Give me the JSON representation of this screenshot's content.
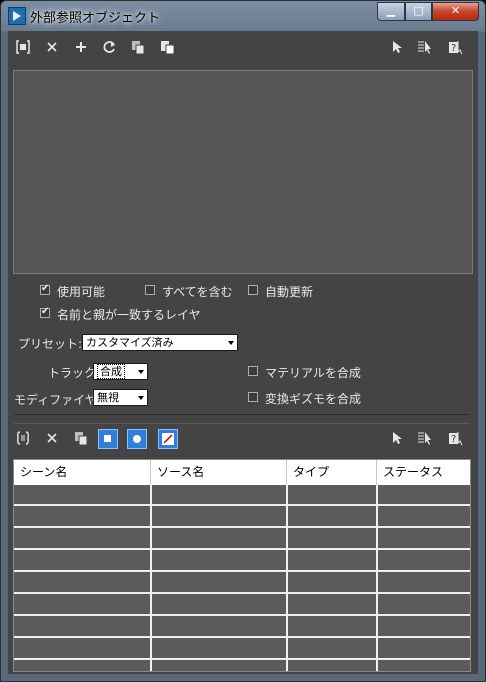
{
  "window": {
    "title": "外部参照オブジェクト",
    "min_glyph": "▁",
    "max_glyph": "□",
    "close_glyph": "✕"
  },
  "toolbar_top": {
    "left_icons": [
      "bracket-object-icon",
      "delete-x-icon",
      "add-plus-icon",
      "refresh-icon",
      "copy-icon",
      "paste-icon"
    ],
    "right_icons": [
      "select-cursor-icon",
      "select-list-icon",
      "help-icon"
    ]
  },
  "options": {
    "enabled": {
      "label": "使用可能",
      "checked": true
    },
    "include_all": {
      "label": "すべてを含む",
      "checked": false
    },
    "auto_update": {
      "label": "自動更新",
      "checked": false
    },
    "match_parent_layer": {
      "label": "名前と親が一致するレイヤ",
      "checked": true
    }
  },
  "preset": {
    "label": "プリセット:",
    "value": "カスタマイズ済み"
  },
  "track": {
    "label": "トラック:",
    "value": "合成"
  },
  "modifier": {
    "label": "モディファイヤ：",
    "value": "無視"
  },
  "merge_material": {
    "label": "マテリアルを合成",
    "checked": false
  },
  "merge_transform_gizmo": {
    "label": "変換ギズモを合成",
    "checked": false
  },
  "toolbar_bottom": {
    "left_icons": [
      "bracket-record-icon",
      "delete-x-icon",
      "copy-icon",
      "object-mode-icon",
      "sphere-mode-icon",
      "edit-mode-icon"
    ],
    "right_icons": [
      "select-cursor-icon",
      "select-list-icon",
      "help-icon"
    ]
  },
  "table": {
    "columns": [
      "シーン名",
      "ソース名",
      "タイプ",
      "ステータス"
    ],
    "rows": 8
  }
}
